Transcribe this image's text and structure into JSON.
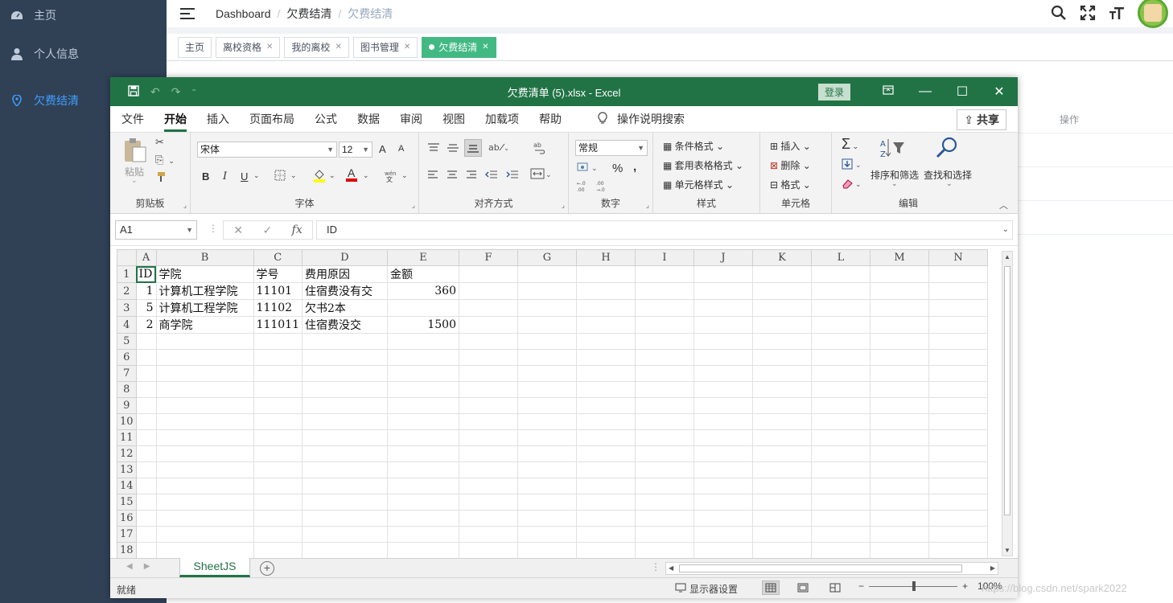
{
  "sidebar": {
    "items": [
      {
        "label": "主页",
        "icon": "dashboard-icon"
      },
      {
        "label": "个人信息",
        "icon": "user-icon"
      },
      {
        "label": "欠费结清",
        "icon": "location-icon"
      }
    ]
  },
  "header": {
    "breadcrumb": [
      "Dashboard",
      "欠费结清",
      "欠费结清"
    ],
    "icons": [
      "search-icon",
      "fullscreen-icon",
      "font-size-icon",
      "avatar"
    ]
  },
  "tags": [
    {
      "label": "主页"
    },
    {
      "label": "离校资格"
    },
    {
      "label": "我的离校"
    },
    {
      "label": "图书管理"
    },
    {
      "label": "欠费结清"
    }
  ],
  "bg_table": {
    "op_header": "操作"
  },
  "excel": {
    "title": "欠费清单 (5).xlsx  -  Excel",
    "login": "登录",
    "menus": [
      "文件",
      "开始",
      "插入",
      "页面布局",
      "公式",
      "数据",
      "审阅",
      "视图",
      "加载项",
      "帮助"
    ],
    "tell_me": "操作说明搜索",
    "share": "共享",
    "ribbon": {
      "clipboard": {
        "paste": "粘贴",
        "label": "剪贴板"
      },
      "font": {
        "name": "宋体",
        "size": "12",
        "label": "字体",
        "bold": "B",
        "italic": "I",
        "underline": "U",
        "a_big": "A",
        "a_small": "A"
      },
      "alignment": {
        "label": "对齐方式"
      },
      "number": {
        "format": "常规",
        "label": "数字",
        "percent": "%",
        "comma": ","
      },
      "styles": {
        "cond": "条件格式",
        "table": "套用表格格式",
        "cell": "单元格样式",
        "label": "样式"
      },
      "cells": {
        "insert": "插入",
        "delete": "删除",
        "format": "格式",
        "label": "单元格"
      },
      "editing": {
        "sort": "排序和筛选",
        "find": "查找和选择",
        "label": "编辑",
        "sigma": "Σ"
      }
    },
    "namebox": "A1",
    "formula": "ID",
    "columns": [
      "A",
      "B",
      "C",
      "D",
      "E",
      "F",
      "G",
      "H",
      "I",
      "J",
      "K",
      "L",
      "M",
      "N"
    ],
    "rows": [
      {
        "n": "1",
        "A": "ID",
        "B": "学院",
        "C": "学号",
        "D": "费用原因",
        "E": "金额"
      },
      {
        "n": "2",
        "A": "1",
        "B": "计算机工程学院",
        "C": "11101",
        "D": "住宿费没有交",
        "E": "360"
      },
      {
        "n": "3",
        "A": "5",
        "B": "计算机工程学院",
        "C": "11102",
        "D": "欠书2本",
        "E": ""
      },
      {
        "n": "4",
        "A": "2",
        "B": "商学院",
        "C": "111011",
        "D": "住宿费没交",
        "E": "1500"
      },
      {
        "n": "5",
        "A": "",
        "B": "",
        "C": "",
        "D": "",
        "E": ""
      },
      {
        "n": "6",
        "A": "",
        "B": "",
        "C": "",
        "D": "",
        "E": ""
      },
      {
        "n": "7",
        "A": "",
        "B": "",
        "C": "",
        "D": "",
        "E": ""
      },
      {
        "n": "8",
        "A": "",
        "B": "",
        "C": "",
        "D": "",
        "E": ""
      },
      {
        "n": "9",
        "A": "",
        "B": "",
        "C": "",
        "D": "",
        "E": ""
      },
      {
        "n": "10",
        "A": "",
        "B": "",
        "C": "",
        "D": "",
        "E": ""
      },
      {
        "n": "11",
        "A": "",
        "B": "",
        "C": "",
        "D": "",
        "E": ""
      },
      {
        "n": "12",
        "A": "",
        "B": "",
        "C": "",
        "D": "",
        "E": ""
      },
      {
        "n": "13",
        "A": "",
        "B": "",
        "C": "",
        "D": "",
        "E": ""
      },
      {
        "n": "14",
        "A": "",
        "B": "",
        "C": "",
        "D": "",
        "E": ""
      },
      {
        "n": "15",
        "A": "",
        "B": "",
        "C": "",
        "D": "",
        "E": ""
      },
      {
        "n": "16",
        "A": "",
        "B": "",
        "C": "",
        "D": "",
        "E": ""
      },
      {
        "n": "17",
        "A": "",
        "B": "",
        "C": "",
        "D": "",
        "E": ""
      },
      {
        "n": "18",
        "A": "",
        "B": "",
        "C": "",
        "D": "",
        "E": ""
      }
    ],
    "sheet_tab": "SheetJS",
    "status": {
      "ready": "就绪",
      "display": "显示器设置",
      "zoom": "100%"
    }
  },
  "watermark": "https://blog.csdn.net/spark2022",
  "colors": {
    "excel_green": "#217346",
    "sidebar": "#304156",
    "active_tag": "#42b983",
    "accent": "#409eff"
  }
}
